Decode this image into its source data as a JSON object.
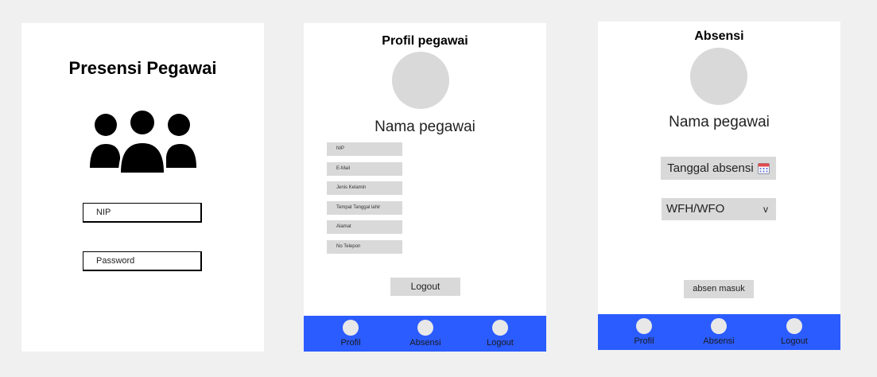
{
  "login": {
    "title": "Presensi Pegawai",
    "nip_placeholder": "NIP",
    "password_placeholder": "Password",
    "icon": "users-icon"
  },
  "profile": {
    "title": "Profil pegawai",
    "name": "Nama pegawai",
    "fields": [
      "NIP",
      "E-Mail",
      "Jenis Kelamin",
      "Tempat Tanggal lahir",
      "Alamat",
      "No Telepon"
    ],
    "logout_label": "Logout"
  },
  "absensi": {
    "title": "Absensi",
    "name": "Nama pegawai",
    "date_label": "Tanggal absensi",
    "mode_value": "WFH/WFO",
    "submit_label": "absen masuk"
  },
  "navbar": {
    "items": [
      "Profil",
      "Absensi",
      "Logout"
    ],
    "color": "#2b5cff"
  },
  "colors": {
    "background": "#f0f0f0",
    "frame": "#ffffff",
    "field": "#d9d9d9"
  }
}
